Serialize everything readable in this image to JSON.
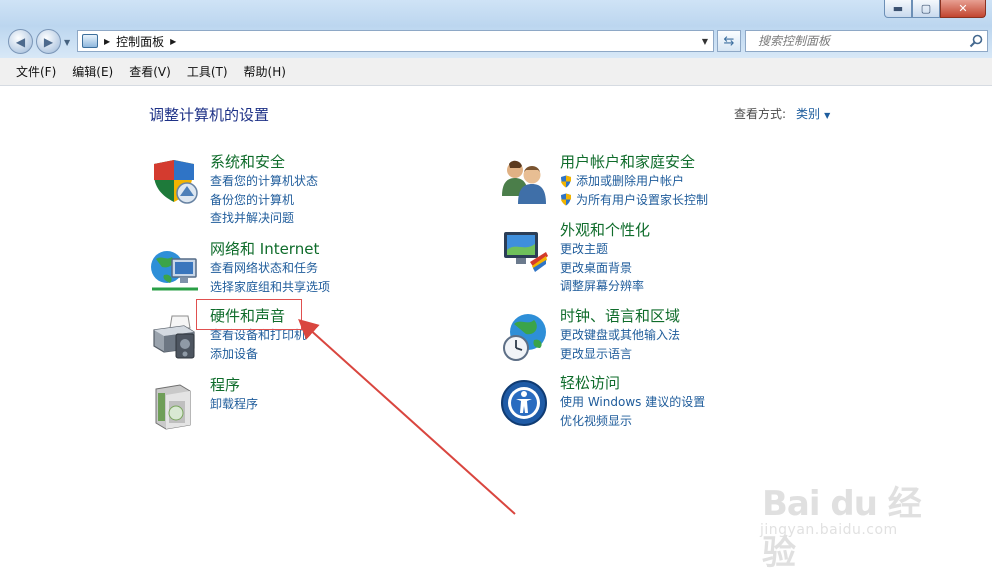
{
  "window": {
    "minimize_glyph": "▬",
    "maximize_glyph": "▢",
    "close_glyph": "✕"
  },
  "address": {
    "breadcrumb": [
      "控制面板"
    ],
    "search_placeholder": "搜索控制面板"
  },
  "menu": [
    "文件(F)",
    "编辑(E)",
    "查看(V)",
    "工具(T)",
    "帮助(H)"
  ],
  "main": {
    "title": "调整计算机的设置",
    "view_by_label": "查看方式:",
    "view_by_value": "类别"
  },
  "categories": [
    {
      "title": "系统和安全",
      "icon": "shield-icon",
      "links": [
        "查看您的计算机状态",
        "备份您的计算机",
        "查找并解决问题"
      ]
    },
    {
      "title": "网络和 Internet",
      "icon": "network-globe-icon",
      "links": [
        "查看网络状态和任务",
        "选择家庭组和共享选项"
      ]
    },
    {
      "title": "硬件和声音",
      "icon": "printer-icon",
      "links": [
        "查看设备和打印机",
        "添加设备"
      ]
    },
    {
      "title": "程序",
      "icon": "programs-box-icon",
      "links": [
        "卸载程序"
      ]
    },
    {
      "title": "用户帐户和家庭安全",
      "icon": "users-icon",
      "links": [
        "添加或删除用户帐户",
        "为所有用户设置家长控制"
      ]
    },
    {
      "title": "外观和个性化",
      "icon": "monitor-palette-icon",
      "links": [
        "更改主题",
        "更改桌面背景",
        "调整屏幕分辨率"
      ]
    },
    {
      "title": "时钟、语言和区域",
      "icon": "clock-globe-icon",
      "links": [
        "更改键盘或其他输入法",
        "更改显示语言"
      ]
    },
    {
      "title": "轻松访问",
      "icon": "ease-of-access-icon",
      "links": [
        "使用 Windows 建议的设置",
        "优化视频显示"
      ]
    }
  ],
  "watermark": {
    "main": "Bai du 经验",
    "sub": "jingyan.baidu.com"
  },
  "colors": {
    "category_title": "#0f6c2b",
    "link": "#1f5c9b",
    "page_title": "#1e3287",
    "highlight": "#e0504f"
  }
}
